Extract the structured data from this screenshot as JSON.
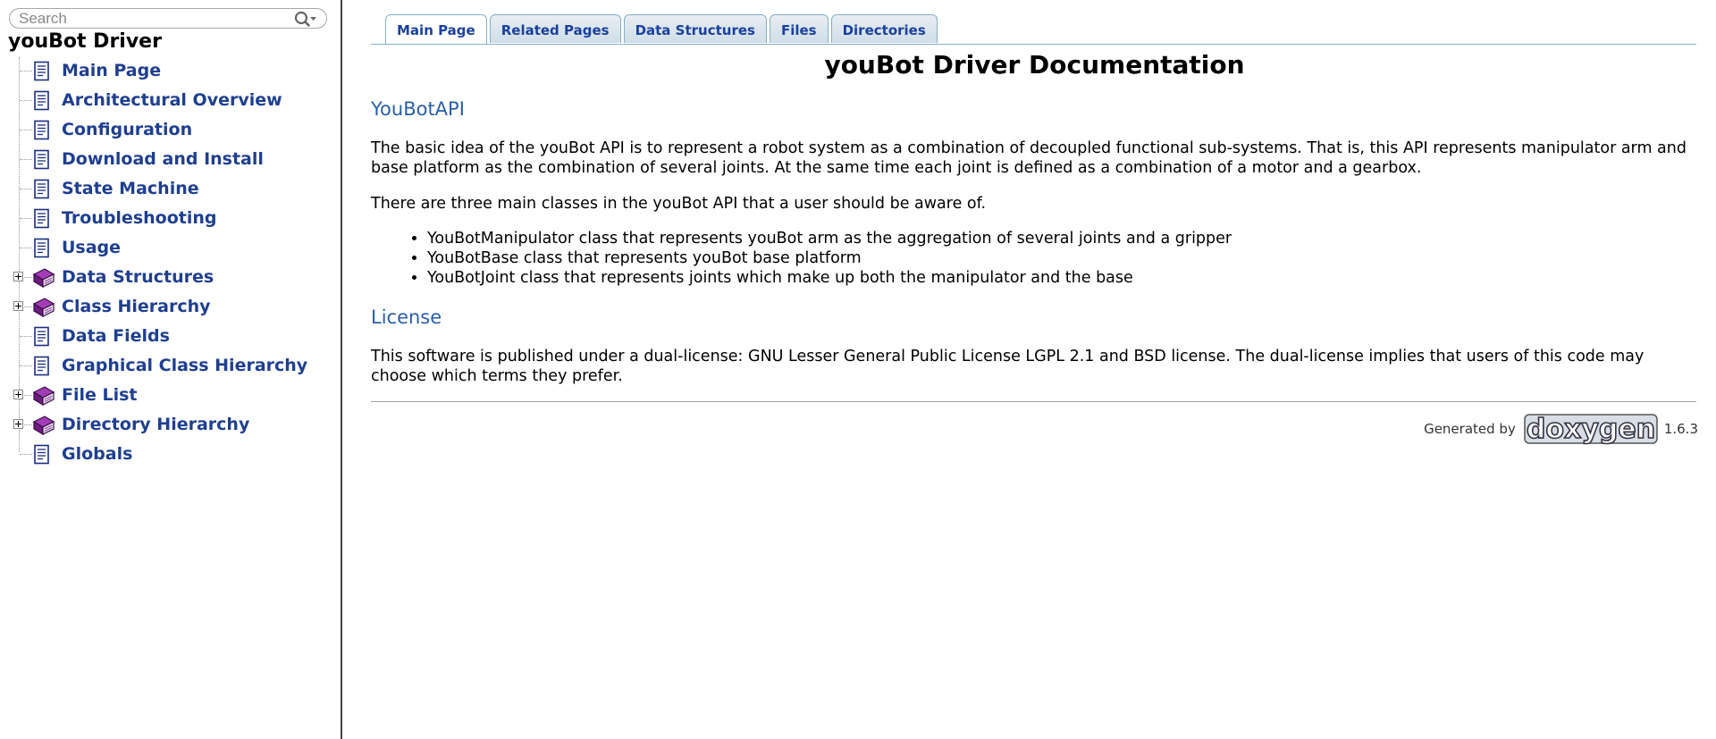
{
  "search": {
    "placeholder": "Search"
  },
  "sidebar": {
    "title": "youBot Driver",
    "items": [
      {
        "label": "Main Page",
        "type": "page",
        "expandable": false
      },
      {
        "label": "Architectural Overview",
        "type": "page",
        "expandable": false
      },
      {
        "label": "Configuration",
        "type": "page",
        "expandable": false
      },
      {
        "label": "Download and Install",
        "type": "page",
        "expandable": false
      },
      {
        "label": "State Machine",
        "type": "page",
        "expandable": false
      },
      {
        "label": "Troubleshooting",
        "type": "page",
        "expandable": false
      },
      {
        "label": "Usage",
        "type": "page",
        "expandable": false
      },
      {
        "label": "Data Structures",
        "type": "book",
        "expandable": true
      },
      {
        "label": "Class Hierarchy",
        "type": "book",
        "expandable": true
      },
      {
        "label": "Data Fields",
        "type": "page",
        "expandable": false
      },
      {
        "label": "Graphical Class Hierarchy",
        "type": "page",
        "expandable": false
      },
      {
        "label": "File List",
        "type": "book",
        "expandable": true
      },
      {
        "label": "Directory Hierarchy",
        "type": "book",
        "expandable": true
      },
      {
        "label": "Globals",
        "type": "page",
        "expandable": false
      }
    ]
  },
  "tabs": [
    {
      "label": "Main Page",
      "active": true
    },
    {
      "label": "Related Pages",
      "active": false
    },
    {
      "label": "Data Structures",
      "active": false
    },
    {
      "label": "Files",
      "active": false
    },
    {
      "label": "Directories",
      "active": false
    }
  ],
  "main": {
    "title": "youBot Driver Documentation",
    "sections": [
      {
        "heading": "YouBotAPI",
        "para1": "The basic idea of the youBot API is to represent a robot system as a combination of decoupled functional sub-systems. That is, this API represents manipulator arm and base platform as the combination of several joints. At the same time each joint is defined as a combination of a motor and a gearbox.",
        "para2": "There are three main classes in the youBot API that a user should be aware of.",
        "list": [
          "YouBotManipulator class that represents youBot arm as the aggregation of several joints and a gripper",
          "YouBotBase class that represents youBot base platform",
          "YouBotJoint class that represents joints which make up both the manipulator and the base"
        ]
      },
      {
        "heading": "License",
        "para1": "This software is published under a dual-license: GNU Lesser General Public License LGPL 2.1 and BSD license. The dual-license implies that users of this code may choose which terms they prefer."
      }
    ]
  },
  "footer": {
    "generated_by": "Generated by",
    "logo_text": "doxygen",
    "version": "1.6.3"
  },
  "icons": {
    "page": "document-page-icon",
    "book": "book-icon",
    "search": "search-icon",
    "expander": "plus-expander-icon"
  },
  "colors": {
    "link": "#1f3f8f",
    "section_heading": "#2a5ea8",
    "tab_text": "#1a419d",
    "tab_border": "#84b0c7",
    "book": "#7a1f8f"
  }
}
